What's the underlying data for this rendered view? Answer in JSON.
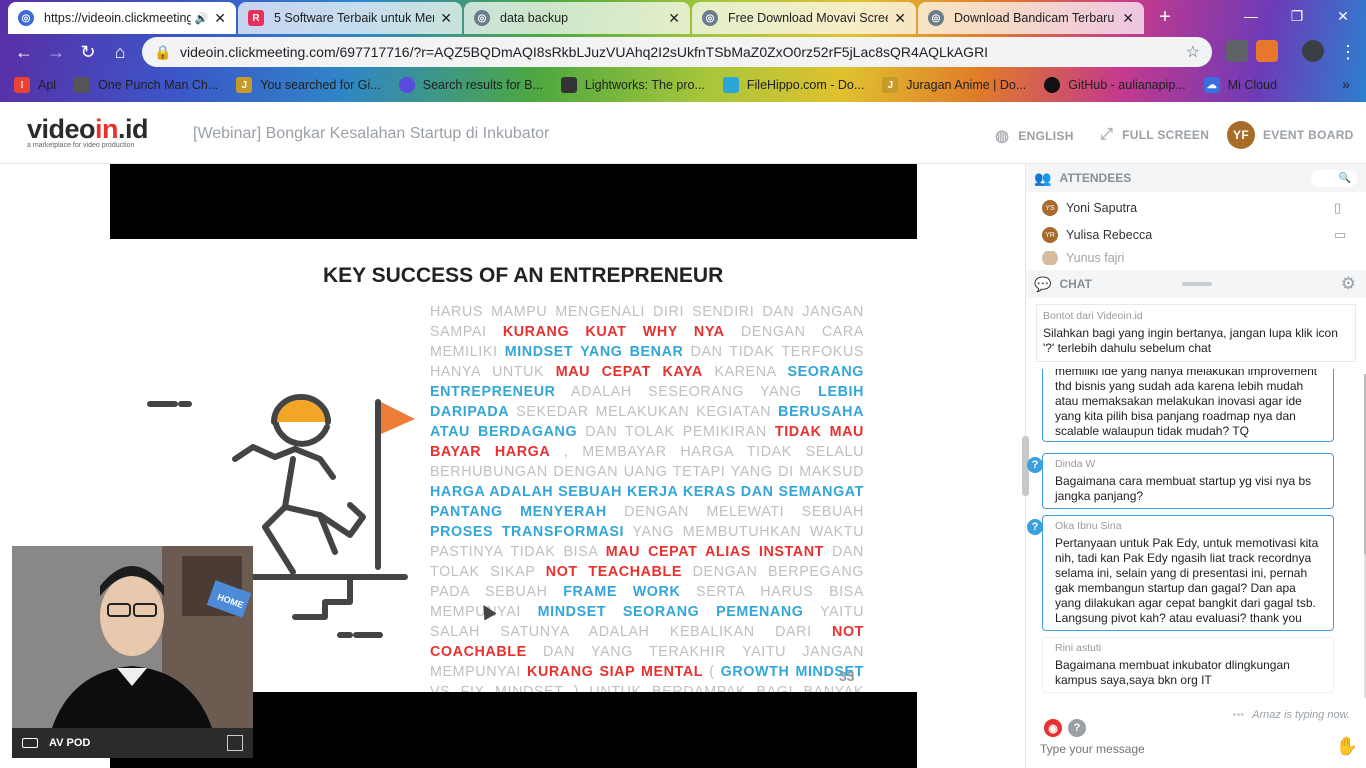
{
  "browser": {
    "tabs": [
      {
        "title": "https://videoin.clickmeeting",
        "icon": "globe-icon",
        "color": "#3c6bd6"
      },
      {
        "title": "5 Software Terbaik untuk Mer",
        "icon": "r-logo-icon",
        "color": "#e8315a"
      },
      {
        "title": "data backup",
        "icon": "globe-icon",
        "color": "#6b7c8a"
      },
      {
        "title": "Free Download Movavi Screen",
        "icon": "globe-icon",
        "color": "#6b7c8a"
      },
      {
        "title": "Download Bandicam Terbaru",
        "icon": "globe-icon",
        "color": "#6b7c8a"
      }
    ],
    "url": "videoin.clickmeeting.com/697717716/?r=AQZ5BQDmAQI8sRkbLJuzVUAhq2I2sUkfnTSbMaZ0ZxO0rz52rF5jLac8sQR4AQLkAGRI",
    "bookmarks": [
      {
        "label": "Apl",
        "color": "#ea4335"
      },
      {
        "label": "One Punch Man Ch...",
        "color": "#555555"
      },
      {
        "label": "You searched for Gi...",
        "color": "#c59a2a"
      },
      {
        "label": "Search results for B...",
        "color": "#5b4ae0"
      },
      {
        "label": "Lightworks: The pro...",
        "color": "#333333"
      },
      {
        "label": "FileHippo.com - Do...",
        "color": "#2aa7d6"
      },
      {
        "label": "Juragan Anime | Do...",
        "color": "#c59a2a"
      },
      {
        "label": "GitHub - aulianapip...",
        "color": "#111111"
      },
      {
        "label": "Mi Cloud",
        "color": "#3a6fe0"
      }
    ]
  },
  "app": {
    "logo_prefix": "video",
    "logo_mid": "in",
    "logo_suffix": ".id",
    "logo_tagline": "a marketplace for video production",
    "event_title": "[Webinar] Bongkar Kesalahan Startup di Inkubator",
    "lang_label": "ENGLISH",
    "fullscreen_label": "FULL SCREEN",
    "user_initials": "YF",
    "eventboard_label": "EVENT BOARD"
  },
  "slide": {
    "title": "KEY SUCCESS OF AN ENTREPRENEUR",
    "page": "33",
    "segments": [
      {
        "t": "Harus mampu mengenali diri sendiri dan jangan sampai ",
        "c": ""
      },
      {
        "t": "KURANG KUAT WHY NYA",
        "c": "r"
      },
      {
        "t": " dengan cara memiliki ",
        "c": ""
      },
      {
        "t": "MINDSET YANG BENAR",
        "c": "b"
      },
      {
        "t": " dan tidak terfokus  hanya untuk ",
        "c": ""
      },
      {
        "t": "MAU CEPAT KAYA",
        "c": "r"
      },
      {
        "t": " karena ",
        "c": ""
      },
      {
        "t": "SEORANG ENTREPRENEUR",
        "c": "b"
      },
      {
        "t": " adalah seseorang yang ",
        "c": ""
      },
      {
        "t": "LEBIH DARIPADA",
        "c": "b"
      },
      {
        "t": " sekedar melakukan kegiatan ",
        "c": ""
      },
      {
        "t": "BERUSAHA ATAU BERDAGANG",
        "c": "b"
      },
      {
        "t": "  dan tolak pemikiran ",
        "c": ""
      },
      {
        "t": "TIDAK MAU BAYAR HARGA",
        "c": "r"
      },
      {
        "t": " , membayar harga tidak selalu berhubungan dengan uang tetapi yang di maksud ",
        "c": ""
      },
      {
        "t": "HARGA ADALAH SEBUAH  KERJA KERAS DAN SEMANGAT PANTANG MENYERAH",
        "c": "b"
      },
      {
        "t": " dengan melewati sebuah ",
        "c": ""
      },
      {
        "t": "PROSES TRANSFORMASI",
        "c": "b"
      },
      {
        "t": " yang membutuhkan waktu pastinya tidak bisa ",
        "c": ""
      },
      {
        "t": "MAU CEPAT ALIAS INSTANT",
        "c": "r"
      },
      {
        "t": " dan tolak sikap ",
        "c": ""
      },
      {
        "t": "NOT TEACHABLE",
        "c": "r"
      },
      {
        "t": " dengan berpegang pada sebuah ",
        "c": ""
      },
      {
        "t": "FRAME WORK",
        "c": "b"
      },
      {
        "t": " serta harus bisa mempunyai ",
        "c": ""
      },
      {
        "t": "MINDSET SEORANG PEMENANG",
        "c": "b"
      },
      {
        "t": " yaitu salah satunya adalah kebalikan dari ",
        "c": ""
      },
      {
        "t": "NOT COACHABLE",
        "c": "r"
      },
      {
        "t": " dan yang terakhir yaitu jangan mempunyai ",
        "c": ""
      },
      {
        "t": "KURANG SIAP MENTAL",
        "c": "r"
      },
      {
        "t": " ( ",
        "c": ""
      },
      {
        "t": "GROWTH MINDSET",
        "c": "b"
      },
      {
        "t": " vs fix mindset ) untuk berdampak bagi banyak orang",
        "c": ""
      }
    ]
  },
  "video": {
    "name": "AV POD",
    "sign_text": "HOME"
  },
  "attendees": {
    "header": "ATTENDEES",
    "list": [
      {
        "initials": "YS",
        "name": "Yoni Saputra"
      },
      {
        "initials": "YR",
        "name": "Yulisa Rebecca"
      },
      {
        "initials": "",
        "name": "Yunus fajri"
      }
    ]
  },
  "chat": {
    "header": "CHAT",
    "pinned": {
      "author": "Bontot dari Videoin.id",
      "text": "Silahkan bagi yang ingin bertanya, jangan lupa klik icon '?' terlebih dahulu sebelum chat"
    },
    "messages": [
      {
        "author": "",
        "text": "memiliki ide yang hanya melakukan improvement thd bisnis yang sudah ada karena lebih mudah atau memaksakan melakukan inovasi agar ide yang kita pilih bisa panjang roadmap nya dan scalable walaupun tidak mudah? TQ",
        "question": false
      },
      {
        "author": "Dinda W",
        "text": "Bagaimana cara membuat startup yg visi nya bs jangka panjang?",
        "question": true
      },
      {
        "author": "Oka Ibnu Sina",
        "text": "Pertanyaan untuk Pak Edy, untuk memotivasi kita nih, tadi kan Pak Edy ngasih liat track recordnya selama ini, selain yang di presentasi ini, pernah gak membangun startup dan gagal? Dan apa yang dilakukan agar cepat bangkit dari gagal tsb. Langsung pivot kah? atau evaluasi? thank you",
        "question": true
      },
      {
        "author": "Rini astuti",
        "text": "Bagaimana membuat inkubator dlingkungan kampus saya,saya bkn org IT",
        "question": false
      }
    ],
    "typing": "Arnaz is typing now.",
    "input_placeholder": "Type your message"
  }
}
